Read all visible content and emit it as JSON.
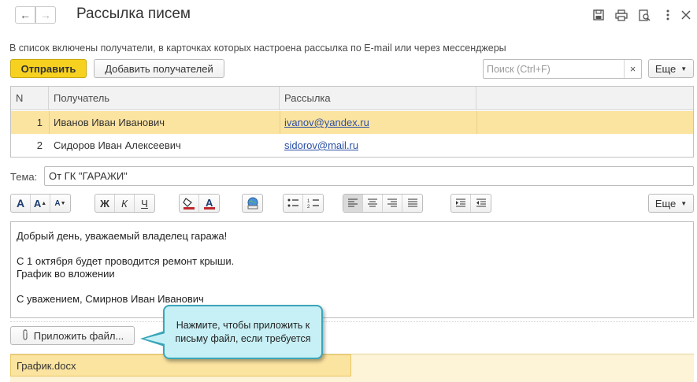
{
  "header": {
    "title": "Рассылка писем",
    "back_icon": "arrow-left-icon",
    "forward_icon": "arrow-right-icon",
    "actions": [
      "save-icon",
      "print-icon",
      "preview-icon",
      "more-vertical-icon",
      "close-icon"
    ]
  },
  "info_text": "В список включены получатели, в карточках которых настроена рассылка по E-mail или через мессенджеры",
  "toolbar": {
    "send_label": "Отправить",
    "add_recipients_label": "Добавить получателей",
    "search_placeholder": "Поиск (Ctrl+F)",
    "more_label": "Еще"
  },
  "table": {
    "columns": [
      "N",
      "Получатель",
      "Рассылка"
    ],
    "rows": [
      {
        "n": "1",
        "recipient": "Иванов Иван Иванович",
        "mailing": "ivanov@yandex.ru",
        "selected": true
      },
      {
        "n": "2",
        "recipient": "Сидоров Иван Алексеевич",
        "mailing": "sidorov@mail.ru",
        "selected": false
      }
    ]
  },
  "subject": {
    "label": "Тема:",
    "value": "От ГК \"ГАРАЖИ\""
  },
  "format_toolbar": {
    "font_group": [
      "A",
      "A",
      "A"
    ],
    "style_group": [
      "Ж",
      "К",
      "Ч"
    ],
    "more_label": "Еще"
  },
  "body_lines": [
    "Добрый день, уважаемый владелец гаража!",
    "",
    "С 1 октября будет проводится ремонт крыши.",
    "График во вложении",
    "",
    "С уважением, Смирнов Иван Иванович"
  ],
  "attach": {
    "button_label": "Приложить файл...",
    "files": [
      "График.docx"
    ]
  },
  "callout": {
    "line1": "Нажмите, чтобы приложить к",
    "line2": "письму файл, если требуется"
  },
  "colors": {
    "accent": "#f6d11f",
    "selection": "#fbe3a0",
    "link": "#2a4fa6",
    "callout_bg": "#c7f0f6",
    "callout_border": "#3aa6b9"
  }
}
